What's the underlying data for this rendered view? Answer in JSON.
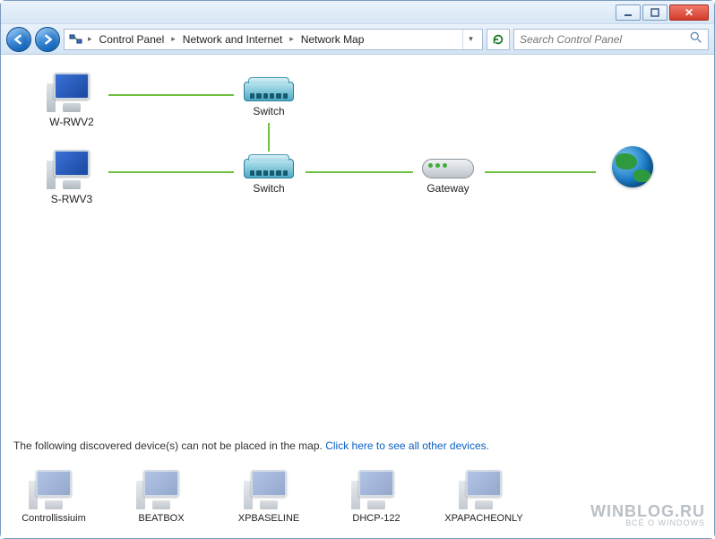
{
  "window": {
    "min_tooltip": "Minimize",
    "max_tooltip": "Maximize",
    "close_tooltip": "Close"
  },
  "nav": {
    "back_tooltip": "Back",
    "forward_tooltip": "Forward",
    "refresh_tooltip": "Refresh",
    "breadcrumbs": [
      "Control Panel",
      "Network and Internet",
      "Network Map"
    ],
    "search_placeholder": "Search Control Panel"
  },
  "map": {
    "row1": {
      "pc": "W-RWV2",
      "switch": "Switch"
    },
    "row2": {
      "pc": "S-RWV3",
      "switch": "Switch",
      "gateway": "Gateway",
      "internet": "Internet"
    }
  },
  "unmapped": {
    "prefix": "The following discovered device(s) can not be placed in the map. ",
    "link": "Click here to see all other devices.",
    "devices": [
      "Controllissiuim",
      "BEATBOX",
      "XPBASELINE",
      "DHCP-122",
      "XPAPACHEONLY"
    ]
  },
  "watermark": {
    "main": "WINBLOG.RU",
    "sub": "ВСЁ О WINDOWS"
  }
}
